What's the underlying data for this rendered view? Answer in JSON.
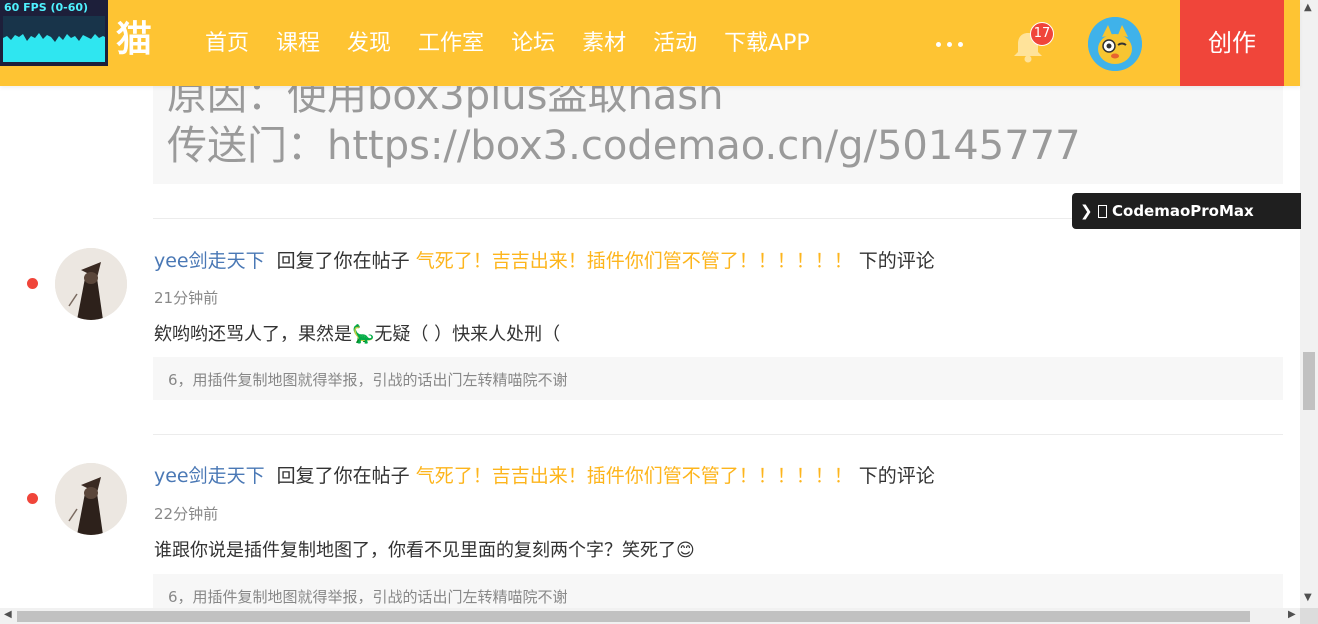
{
  "fps_meter": {
    "label": "60 FPS (0-60)"
  },
  "header": {
    "logo": "猫",
    "nav": [
      "首页",
      "课程",
      "发现",
      "工作室",
      "论坛",
      "素材",
      "活动",
      "下载APP"
    ],
    "notification_count": "17",
    "create_label": "创作",
    "colors": {
      "bar": "#fec433",
      "create": "#f0453a"
    }
  },
  "quote": {
    "line1": "原因：使用box3plus盗取hash",
    "line2": "传送门：https://box3.codemao.cn/g/50145777"
  },
  "tooltip": {
    "label": "CodemaoProMax",
    "icon": "chevron-right-icon"
  },
  "notifications": [
    {
      "user": "yee剑走天下",
      "action": "回复了你在帖子",
      "post_title": "气死了！吉吉出来！插件你们管不管了！！！！！！",
      "suffix": "下的评论",
      "time": "21分钟前",
      "content": "欸哟哟还骂人了，果然是�according无疑（ ）快来人处刑（",
      "quoted": "6，用插件复制地图就得举报，引战的话出门左转精喵院不谢"
    },
    {
      "user": "yee剑走天下",
      "action": "回复了你在帖子",
      "post_title": "气死了！吉吉出来！插件你们管不管了！！！！！！",
      "suffix": "下的评论",
      "time": "22分钟前",
      "content": "谁跟你说是插件复制地图了，你看不见里面的复刻两个字？笑死了😊",
      "quoted": "6，用插件复制地图就得举报，引战的话出门左转精喵院不谢"
    }
  ]
}
